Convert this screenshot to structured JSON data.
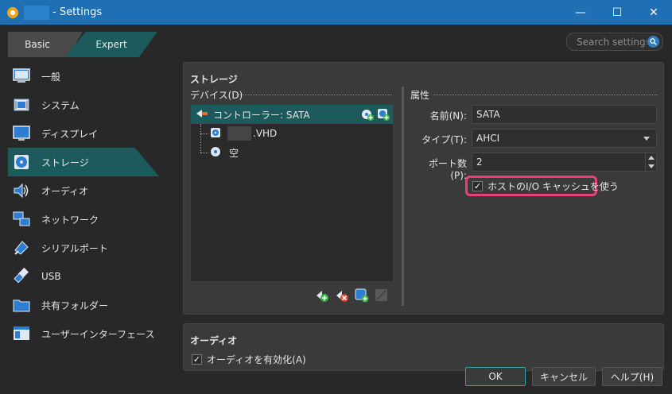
{
  "window": {
    "title_suffix": "- Settings",
    "controls": [
      "—",
      "☐",
      "✕"
    ]
  },
  "tabs": {
    "basic": "Basic",
    "expert": "Expert"
  },
  "search": {
    "placeholder": "Search settings"
  },
  "sidebar": {
    "items": [
      {
        "label": "一般",
        "icon": "general-icon"
      },
      {
        "label": "システム",
        "icon": "system-icon"
      },
      {
        "label": "ディスプレイ",
        "icon": "display-icon"
      },
      {
        "label": "ストレージ",
        "icon": "storage-icon",
        "active": true
      },
      {
        "label": "オーディオ",
        "icon": "audio-icon"
      },
      {
        "label": "ネットワーク",
        "icon": "network-icon"
      },
      {
        "label": "シリアルポート",
        "icon": "serial-port-icon"
      },
      {
        "label": "USB",
        "icon": "usb-icon"
      },
      {
        "label": "共有フォルダー",
        "icon": "shared-folder-icon"
      },
      {
        "label": "ユーザーインターフェース",
        "icon": "user-interface-icon"
      }
    ]
  },
  "storage": {
    "title": "ストレージ",
    "devices_label": "デバイス(D)",
    "tree": {
      "controller": "コントローラー: SATA",
      "disk": ".VHD",
      "optical": "空"
    },
    "attributes": {
      "label": "属性",
      "name_label": "名前(N):",
      "name_value": "SATA",
      "type_label": "タイプ(T):",
      "type_value": "AHCI",
      "port_label": "ポート数(P):",
      "port_value": "2",
      "host_io_cache": "ホストのI/O キャッシュを使う",
      "host_io_cache_checked": true
    }
  },
  "audio": {
    "title": "オーディオ",
    "enable_label": "オーディオを有効化(A)",
    "enabled": true
  },
  "footer": {
    "ok": "OK",
    "cancel": "キャンセル",
    "help": "ヘルプ(H)"
  },
  "colors": {
    "titlebar": "#1f6fb5",
    "accent": "#1c5a5c",
    "highlight": "#e8407a",
    "background": "#282828",
    "panel": "#3a3a3a"
  }
}
